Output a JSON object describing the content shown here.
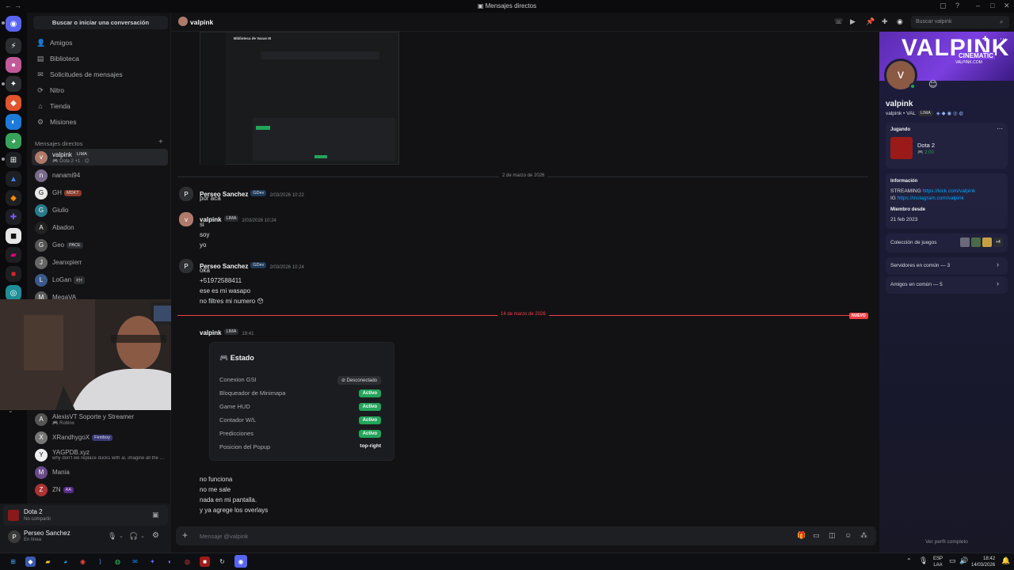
{
  "window": {
    "title": "Mensajes directos"
  },
  "dm_sidebar": {
    "search_label": "Buscar o iniciar una conversación",
    "nav": [
      {
        "label": "Amigos",
        "icon": "friends-icon"
      },
      {
        "label": "Biblioteca",
        "icon": "library-icon"
      },
      {
        "label": "Solicitudes de mensajes",
        "icon": "mail-icon"
      },
      {
        "label": "Nitro",
        "icon": "nitro-icon"
      },
      {
        "label": "Tienda",
        "icon": "shop-icon"
      },
      {
        "label": "Misiones",
        "icon": "quests-icon"
      }
    ],
    "section_title": "Mensajes directos",
    "section_add": "+",
    "dms": [
      {
        "name": "valpink",
        "tag": "LIMA",
        "sub": "Dota 2 +1 ·"
      },
      {
        "name": "nanami94",
        "tag": "",
        "sub": ""
      },
      {
        "name": "GH",
        "tag": "MDKT",
        "sub": ""
      },
      {
        "name": "Giulio",
        "tag": "",
        "sub": ""
      },
      {
        "name": "Abadon",
        "tag": "",
        "sub": ""
      },
      {
        "name": "Geo",
        "tag": "PACE",
        "sub": ""
      },
      {
        "name": "Jeanxpierr",
        "tag": "",
        "sub": ""
      },
      {
        "name": "LoGan",
        "tag": "ｷｳｲ",
        "sub": ""
      },
      {
        "name": "MegaVA",
        "tag": "",
        "sub": ""
      }
    ],
    "dms_lower": [
      {
        "name": "AlexisVT Soporte y Streamer",
        "tag": "",
        "sub": "Roblox"
      },
      {
        "name": "XRandhygoX",
        "tag": "Femboy",
        "sub": ""
      },
      {
        "name": "YAGPDB.xyz",
        "tag": "",
        "sub": "why don't we replace ducks with ai, imagine all the br..."
      },
      {
        "name": "Mania",
        "tag": "",
        "sub": ""
      },
      {
        "name": "ZN",
        "tag": "AA",
        "sub": ""
      }
    ],
    "activity": {
      "game": "Dota 2",
      "status": "No compartir"
    },
    "user": {
      "name": "Perseo Sanchez",
      "status": "En línea"
    }
  },
  "chat_header": {
    "name": "valpink",
    "search_placeholder": "Buscar valpink"
  },
  "embed_screenshot": {
    "title": "Biblioteca de Vacas III"
  },
  "messages": {
    "date1": "2 de marzo de 2026",
    "m1": {
      "author": "Perseo Sanchez",
      "tag": "GDev",
      "time": "2/03/2026 10:22",
      "lines": [
        "por aca"
      ]
    },
    "m2": {
      "author": "valpink",
      "tag": "LIMA",
      "time": "2/03/2026 10:24",
      "lines": [
        "si",
        "soy",
        "yo"
      ]
    },
    "m3": {
      "author": "Perseo Sanchez",
      "tag": "GDev",
      "time": "2/03/2026 10:24",
      "lines": [
        "oka",
        "+51972588411",
        "ese es mi wasapo",
        "no filtres mi numero"
      ]
    },
    "date2": "14 de marzo de 2026",
    "new_badge": "NUEVO",
    "m4": {
      "author": "valpink",
      "tag": "LIMA",
      "time": "19:41"
    },
    "m5_lines": [
      "no funciona",
      "no me sale",
      "nada en mi pantalla.",
      "y ya agrege los overlays"
    ]
  },
  "estado": {
    "title": "Estado",
    "rows": [
      {
        "label": "Conexion GSI",
        "value": "Desconectado",
        "kind": "off"
      },
      {
        "label": "Bloqueador de Minimapa",
        "value": "Activo",
        "kind": "on"
      },
      {
        "label": "Game HUD",
        "value": "Activo",
        "kind": "on"
      },
      {
        "label": "Contador W/L",
        "value": "Activo",
        "kind": "on"
      },
      {
        "label": "Predicciones",
        "value": "Activo",
        "kind": "on"
      },
      {
        "label": "Posicion del Popup",
        "value": "top-right",
        "kind": "text"
      }
    ]
  },
  "composer": {
    "placeholder": "Mensaje @valpink"
  },
  "profile": {
    "banner_text": "VALPINK",
    "banner_sub": "CINEMATIC",
    "banner_url": "VALPINK.COM",
    "name": "valpink",
    "handle": "valpink • VAL",
    "tag": "LIMA",
    "playing_label": "Jugando",
    "game": "Dota 2",
    "game_time": "2:00",
    "info_label": "Información",
    "streaming_label": "STREAMING",
    "streaming_link": "https://kick.com/valpink",
    "ig_label": "IG",
    "ig_link": "https://instagram.com/valpink",
    "member_label": "Miembro desde",
    "member_since": "21 feb 2023",
    "games_label": "Colección de juegos",
    "games_more": "+4",
    "servers": "Servidores en común — 3",
    "friends": "Amigos en común — 5",
    "full_profile": "Ver perfil completo"
  },
  "taskbar": {
    "lang": "ESP",
    "lang2": "LAA",
    "time": "18:42",
    "date": "14/03/2026"
  },
  "colors": {
    "accent": "#5865f2",
    "online": "#23a55a",
    "danger": "#f23f43"
  }
}
